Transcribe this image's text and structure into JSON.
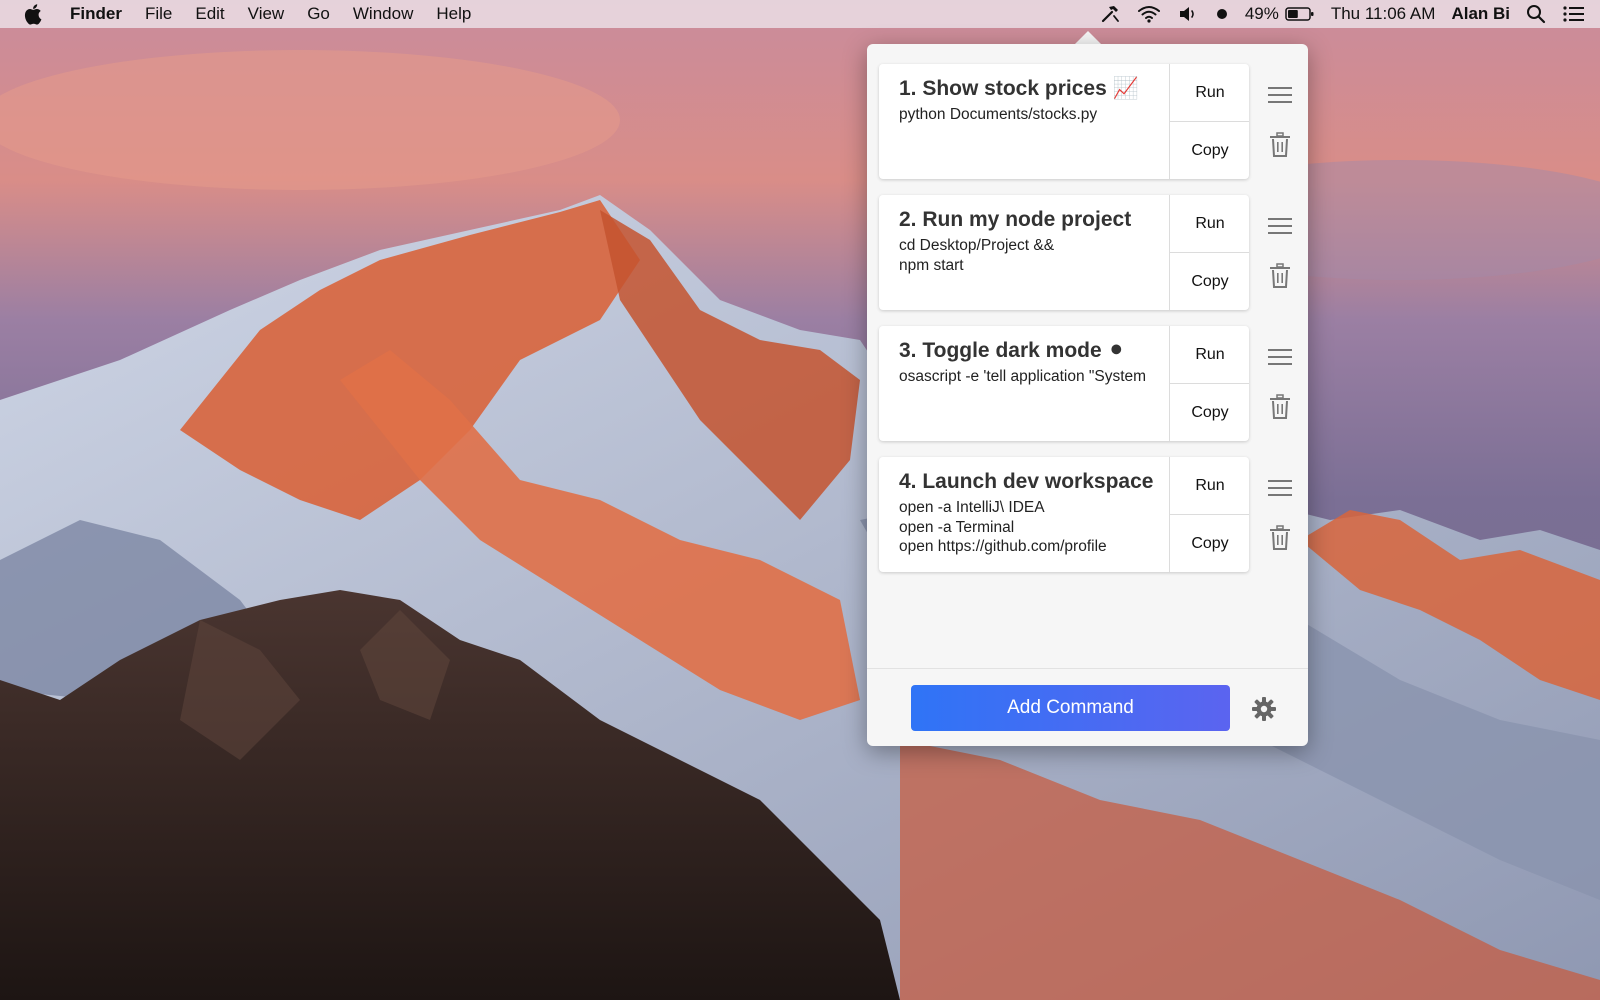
{
  "menubar": {
    "apple_icon": "apple-logo-icon",
    "app_name": "Finder",
    "menus": [
      "File",
      "Edit",
      "View",
      "Go",
      "Window",
      "Help"
    ],
    "status": {
      "hammer_icon": "hammer-icon",
      "wifi_icon": "wifi-icon",
      "volume_icon": "volume-icon",
      "record_icon": "record-dot-icon",
      "battery_percent": "49%",
      "battery_level": 0.49,
      "clock": "Thu 11:06 AM",
      "user": "Alan Bi",
      "spotlight_icon": "search-icon",
      "notifications_icon": "list-icon"
    }
  },
  "popover": {
    "commands": [
      {
        "title": "1. Show stock prices 📈",
        "script": "python Documents/stocks.py",
        "run_label": "Run",
        "copy_label": "Copy"
      },
      {
        "title": "2. Run my node project",
        "script": "cd Desktop/Project &&\nnpm start",
        "run_label": "Run",
        "copy_label": "Copy"
      },
      {
        "title": "3. Toggle dark mode ⚫",
        "script": "osascript -e 'tell application \"System",
        "run_label": "Run",
        "copy_label": "Copy"
      },
      {
        "title": "4. Launch dev workspace",
        "script": "open -a IntelliJ\\ IDEA\nopen -a Terminal\nopen https://github.com/profile",
        "run_label": "Run",
        "copy_label": "Copy"
      }
    ],
    "add_button_label": "Add Command",
    "colors": {
      "add_button_start": "#2f74f6",
      "add_button_end": "#5b64f0",
      "panel_background": "#f6f6f6"
    }
  }
}
